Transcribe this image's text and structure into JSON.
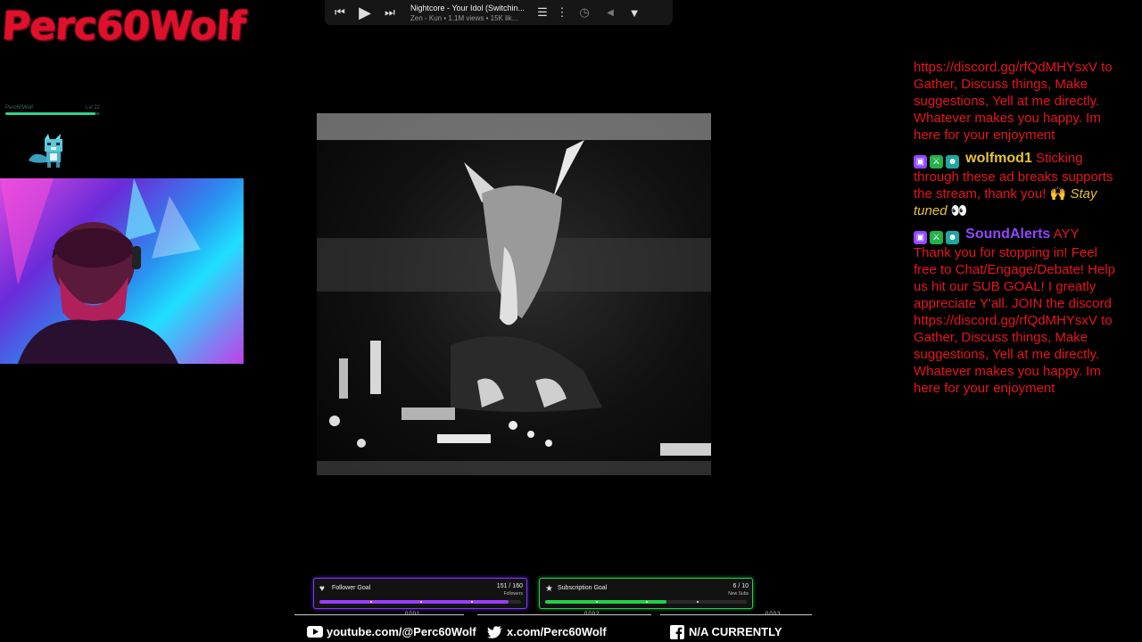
{
  "brand": {
    "logo_text": "Perc60Wolf"
  },
  "level_widget": {
    "name": "Perc60Wolf",
    "level": "Lvl 22",
    "progress": 0.95
  },
  "player": {
    "title": "Nightcore - Your Idol (Switchin...",
    "subtitle": "Zen - Kun • 1.1M views • 15K lik...",
    "icons": [
      "previous-icon",
      "play-icon",
      "next-icon",
      "queue-icon",
      "more-icon",
      "timer-icon",
      "back-icon",
      "dropdown-icon"
    ]
  },
  "chat": {
    "messages": [
      {
        "user": "",
        "text": "https://discord.gg/rfQdMHYsxV to Gather, Discuss things, Make suggestions, Yell at me directly. Whatever makes you happy. Im here for your enjoyment"
      },
      {
        "user": "wolfmod1",
        "text": "Sticking through these ad breaks supports the stream, thank you!",
        "emote_text": "Stay tuned"
      },
      {
        "user": "SoundAlerts",
        "text": "AYY Thank you for stopping in! Feel free to Chat/Engage/Debate! Help us hit our SUB GOAL! I greatly appreciate Y'all. JOIN the discord https://discord.gg/rfQdMHYsxV to Gather, Discuss things, Make suggestions, Yell at me directly. Whatever makes you happy. Im here for your enjoyment"
      }
    ]
  },
  "goals": {
    "follower": {
      "label": "Follower Goal",
      "count": "151 / 160",
      "unit": "Followers",
      "progress": 0.94,
      "color": "#9a3cff"
    },
    "subscription": {
      "label": "Subscription Goal",
      "count": "6 / 10",
      "unit": "New Subs",
      "progress": 0.6,
      "color": "#23d14a"
    }
  },
  "social": {
    "youtube": {
      "num": "0001",
      "text": "youtube.com/@Perc60Wolf"
    },
    "twitter": {
      "num": "0002",
      "text": "x.com/Perc60Wolf"
    },
    "facebook": {
      "num": "0003",
      "text": "N/A CURRENTLY"
    }
  },
  "colors": {
    "chat_text": "#e8141e",
    "accent_gold": "#e8c23a",
    "accent_purple": "#9147ff",
    "logo": "#e0102b"
  }
}
